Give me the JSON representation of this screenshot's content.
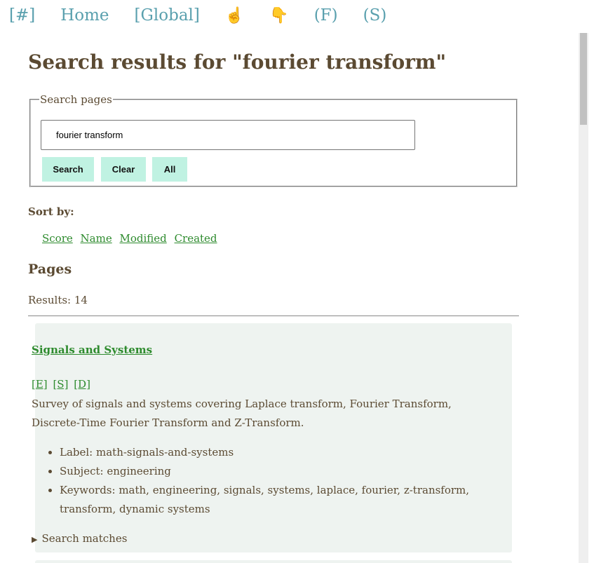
{
  "topnav": [
    {
      "name": "nav-hash-link",
      "label": "[#]"
    },
    {
      "name": "nav-home-link",
      "label": "Home"
    },
    {
      "name": "nav-global-link",
      "label": "[Global]"
    },
    {
      "name": "nav-point-up-link",
      "label": "☝"
    },
    {
      "name": "nav-point-down-link",
      "label": "👇"
    },
    {
      "name": "nav-f-link",
      "label": "(F)"
    },
    {
      "name": "nav-s-link",
      "label": "(S)"
    }
  ],
  "page_title": "Search results for \"fourier transform\"",
  "search": {
    "legend": "Search pages",
    "value": "fourier transform",
    "buttons": {
      "search": "Search",
      "clear": "Clear",
      "all": "All"
    }
  },
  "sort": {
    "label": "Sort by:",
    "options": [
      "Score",
      "Name",
      "Modified",
      "Created"
    ]
  },
  "pages_heading": "Pages",
  "results_count": "Results: 14",
  "results": [
    {
      "title": "Signals and Systems",
      "links": [
        "[E]",
        "[S]",
        "[D]"
      ],
      "description": "Survey of signals and systems covering Laplace transform, Fourier Transform, Discrete-Time Fourier Transform and Z-Transform.",
      "meta": [
        "Label: math-signals-and-systems",
        "Subject: engineering",
        "Keywords: math, engineering, signals, systems, laplace, fourier, z-transform, transform, dynamic systems"
      ],
      "matches_label": "Search matches"
    }
  ],
  "colors": {
    "nav_link": "#5aa0ae",
    "text": "#5b4a32",
    "link": "#2e8b2e",
    "button_bg": "#c0f2e2",
    "card_bg": "#eef3f0"
  }
}
